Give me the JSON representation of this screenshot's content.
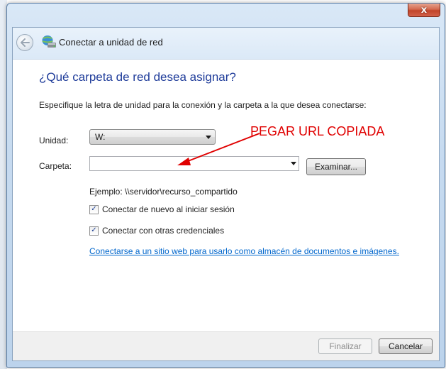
{
  "window": {
    "title": "Conectar a unidad de red",
    "close_glyph": "x"
  },
  "page": {
    "question": "¿Qué carpeta de red desea asignar?",
    "instructions": "Especifique la letra de unidad para la conexión y la carpeta a la que desea conectarse:"
  },
  "form": {
    "drive_label": "Unidad:",
    "drive_value": "W:",
    "folder_label": "Carpeta:",
    "folder_value": "",
    "browse_label": "Examinar...",
    "example": "Ejemplo: \\\\servidor\\recurso_compartido",
    "reconnect_label": "Conectar de nuevo al iniciar sesión",
    "reconnect_checked": true,
    "credentials_label": "Conectar con otras credenciales",
    "credentials_checked": true,
    "link_text": "Conectarse a un sitio web para usarlo como almacén de documentos e imágenes."
  },
  "annotation": {
    "text": "PEGAR URL COPIADA",
    "color": "#e00000"
  },
  "footer": {
    "finish_label": "Finalizar",
    "cancel_label": "Cancelar"
  },
  "icons": {
    "back": "back-arrow-icon",
    "network": "network-drive-icon",
    "close": "close-icon",
    "dropdown": "chevron-down-icon",
    "check": "checkmark-icon"
  }
}
